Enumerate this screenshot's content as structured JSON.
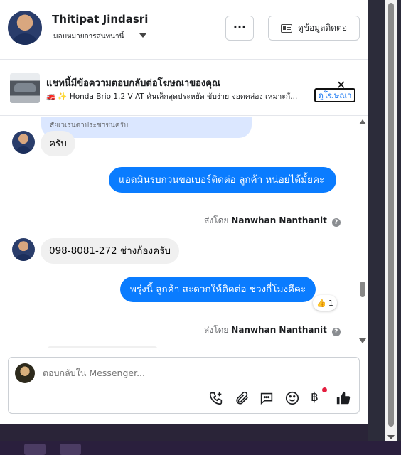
{
  "header": {
    "name": "Thitipat Jindasri",
    "subtitle": "มอบหมายการสนทนานี้",
    "more_label": "···",
    "contact_label": "ดูข้อมูลติดต่อ"
  },
  "ad_banner": {
    "title": "แชทนี้มีข้อความตอบกลับต่อโฆษณาของคุณ",
    "text": "🚒 ✨ Honda Brio 1.2 V AT คันเล็กสุดประหยัด ขับง่าย จอดคล่อง เหมาะกั...",
    "link_label": "ดูโฆษณา",
    "close_label": "✕"
  },
  "messages": {
    "top_partial": "สัยเวเรนตาประชาชนครับ",
    "m1": "ครับ",
    "m2": "แอดมินรบกวนขอเบอร์ติดต่อ ลูกค้า หน่อยได้มั้ยคะ",
    "m2_sent_prefix": "ส่งโดย",
    "m2_sent_name": "Nanwhan Nanthanit",
    "m3": "098-8081-272 ช่างก้องครับ",
    "m4": "พรุ่งนี้ ลูกค้า  สะดวกให้ติดต่อ ช่วงกี่โมงดีคะ",
    "m4_reaction_emoji": "👍",
    "m4_reaction_count": "1",
    "m4_sent_prefix": "ส่งโดย",
    "m4_sent_name": "Nanwhan Nanthanit",
    "info_glyph": "?"
  },
  "composer": {
    "placeholder": "ตอบกลับใน Messenger...",
    "icons": [
      "phone-plus-icon",
      "paperclip-icon",
      "chat-bubble-icon",
      "emoji-icon",
      "baht-icon",
      "like-icon"
    ],
    "baht_glyph": "฿"
  },
  "colors": {
    "outgoing_bubble": "#0a7cff",
    "incoming_bubble": "#f0f0f0",
    "link": "#1877f2"
  }
}
